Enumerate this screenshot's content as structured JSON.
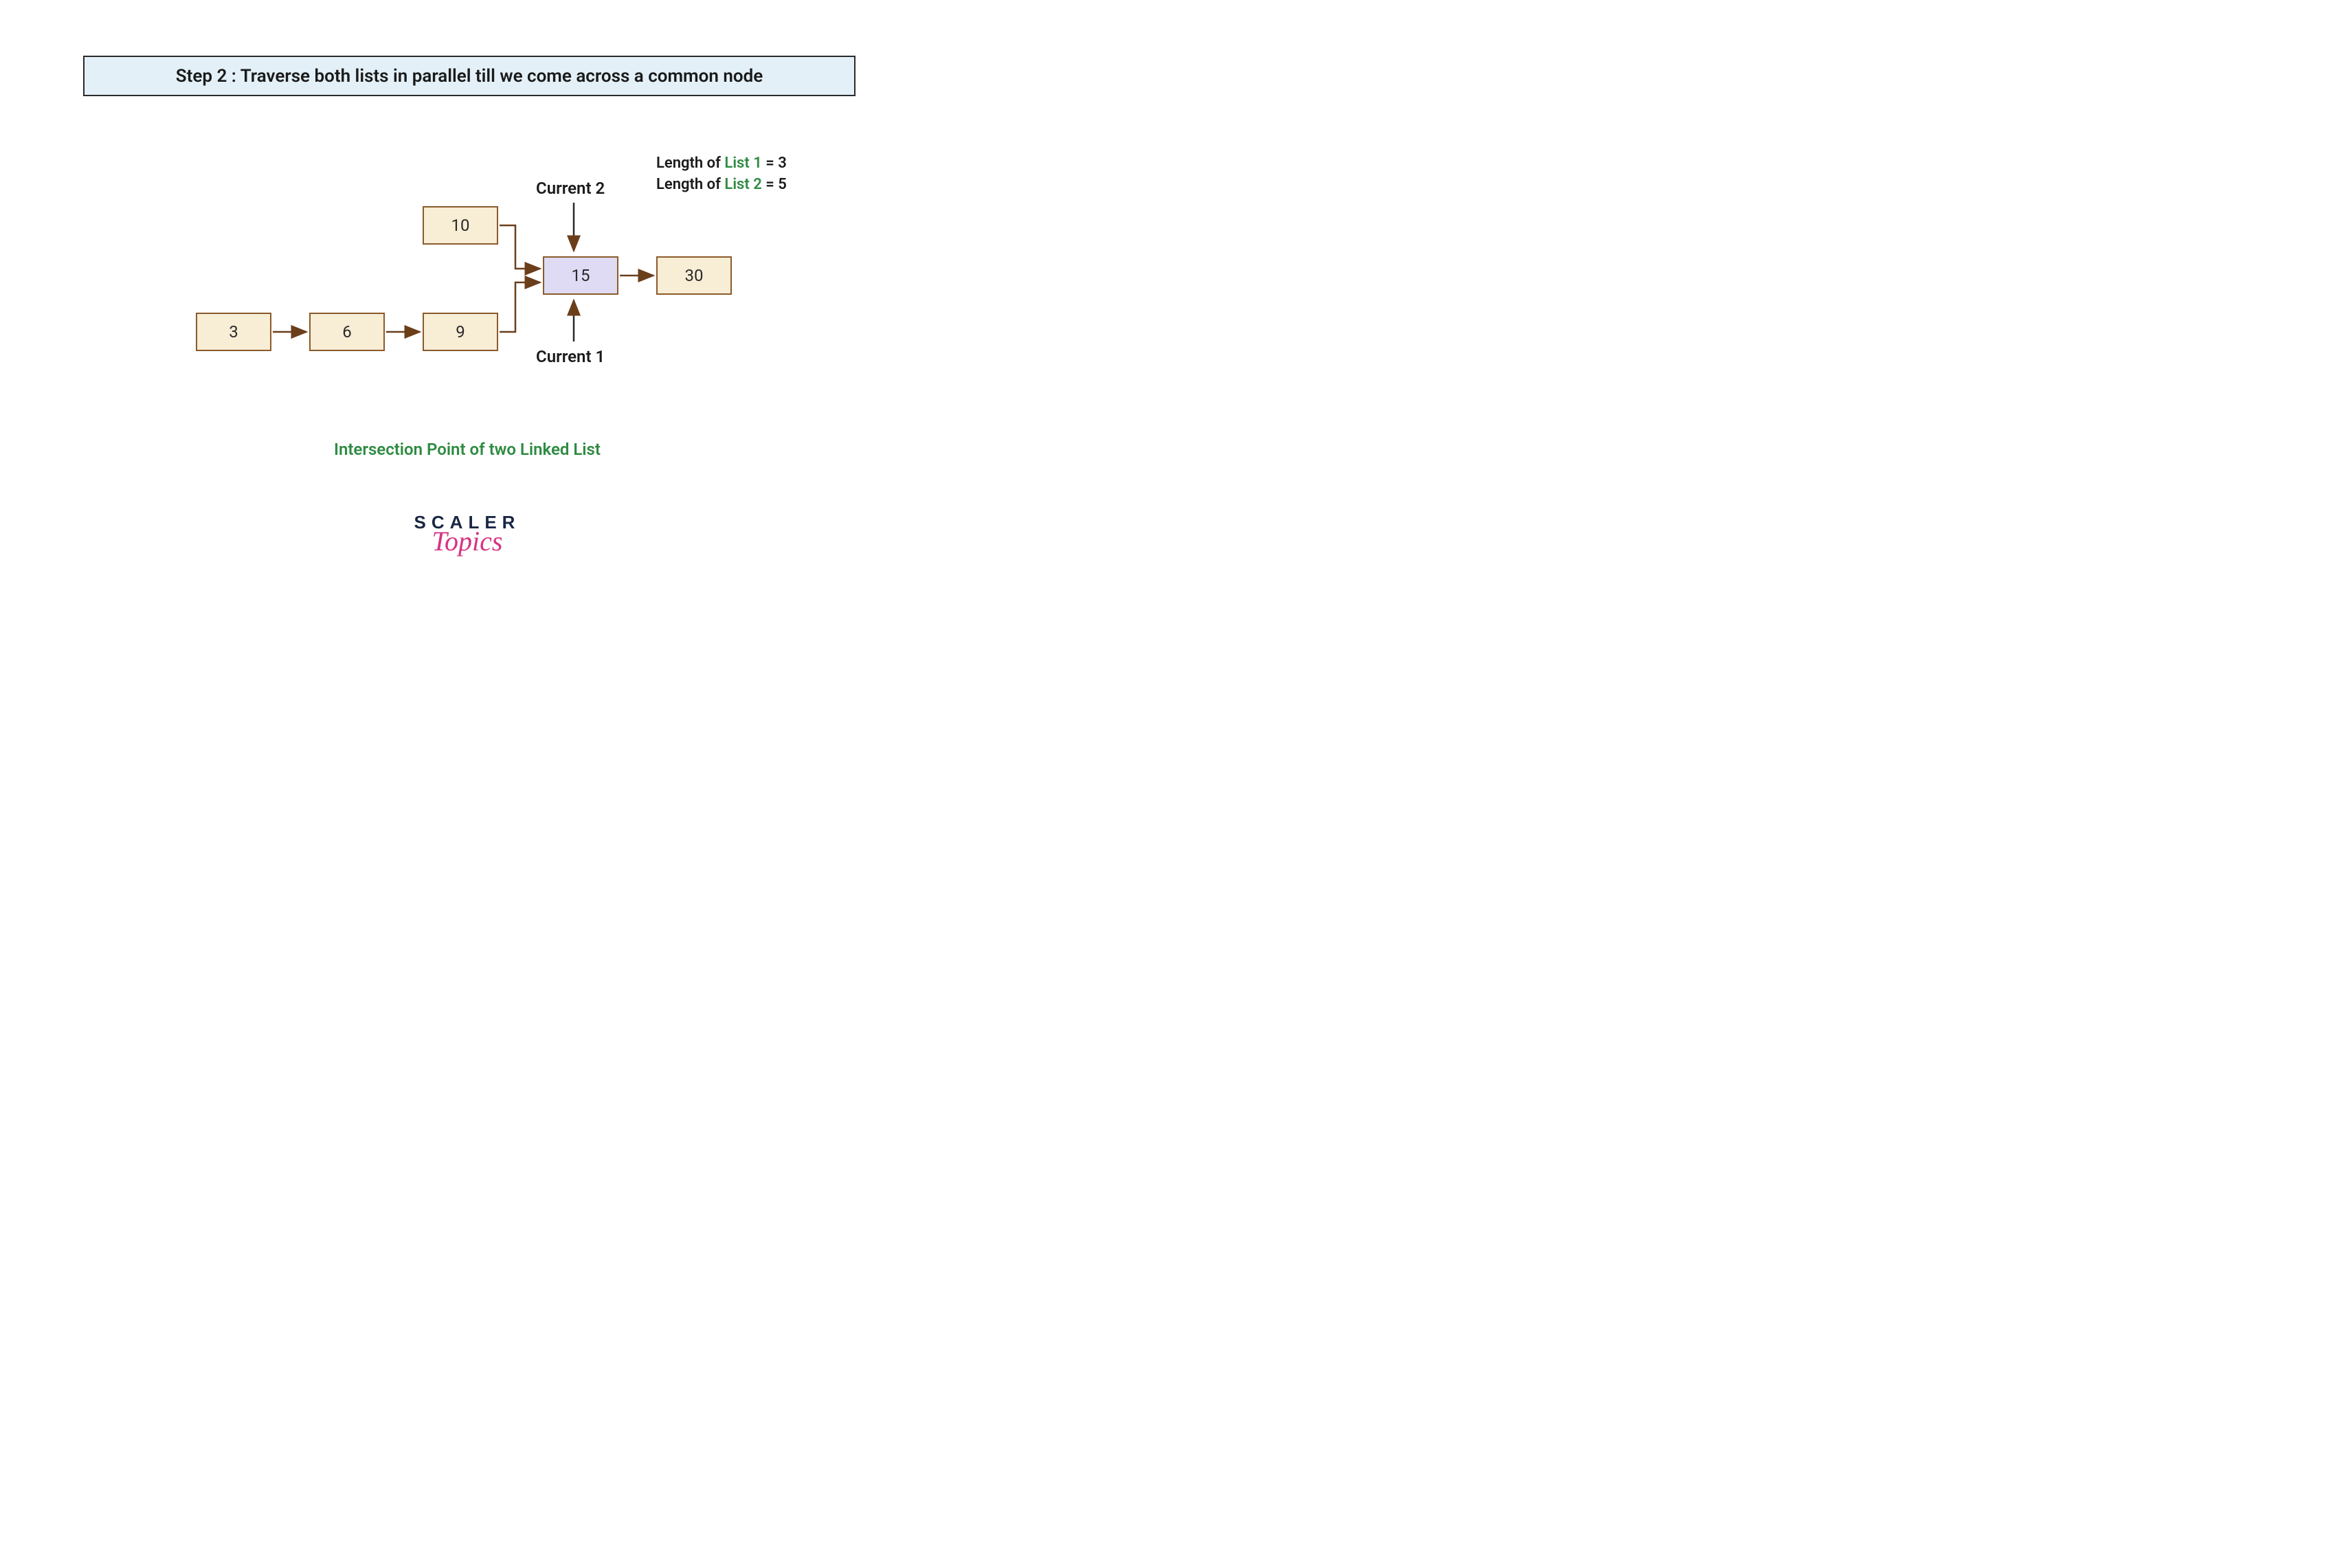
{
  "banner": {
    "text": "Step 2 : Traverse both lists in parallel till we come across a common node"
  },
  "lengths": {
    "list1_prefix": "Length of ",
    "list1_name": "List 1",
    "list1_suffix": " = 3",
    "list2_prefix": "Length of ",
    "list2_name": "List 2",
    "list2_suffix": " = 5"
  },
  "nodes": {
    "n3": "3",
    "n6": "6",
    "n9": "9",
    "n10": "10",
    "n15": "15",
    "n30": "30"
  },
  "pointers": {
    "current1": "Current 1",
    "current2": "Current 2"
  },
  "caption": "Intersection Point of two Linked List",
  "logo": {
    "line1": "SCALER",
    "line2": "Topics"
  },
  "chart_data": {
    "type": "diagram",
    "description": "Linked list intersection diagram",
    "list1": [
      3,
      6,
      9,
      15,
      30
    ],
    "list2": [
      10,
      15,
      30
    ],
    "intersection_node": 15,
    "length_list1": 3,
    "length_list2": 5,
    "current1_at": 15,
    "current2_at": 15,
    "step": 2,
    "step_description": "Traverse both lists in parallel till we come across a common node"
  }
}
